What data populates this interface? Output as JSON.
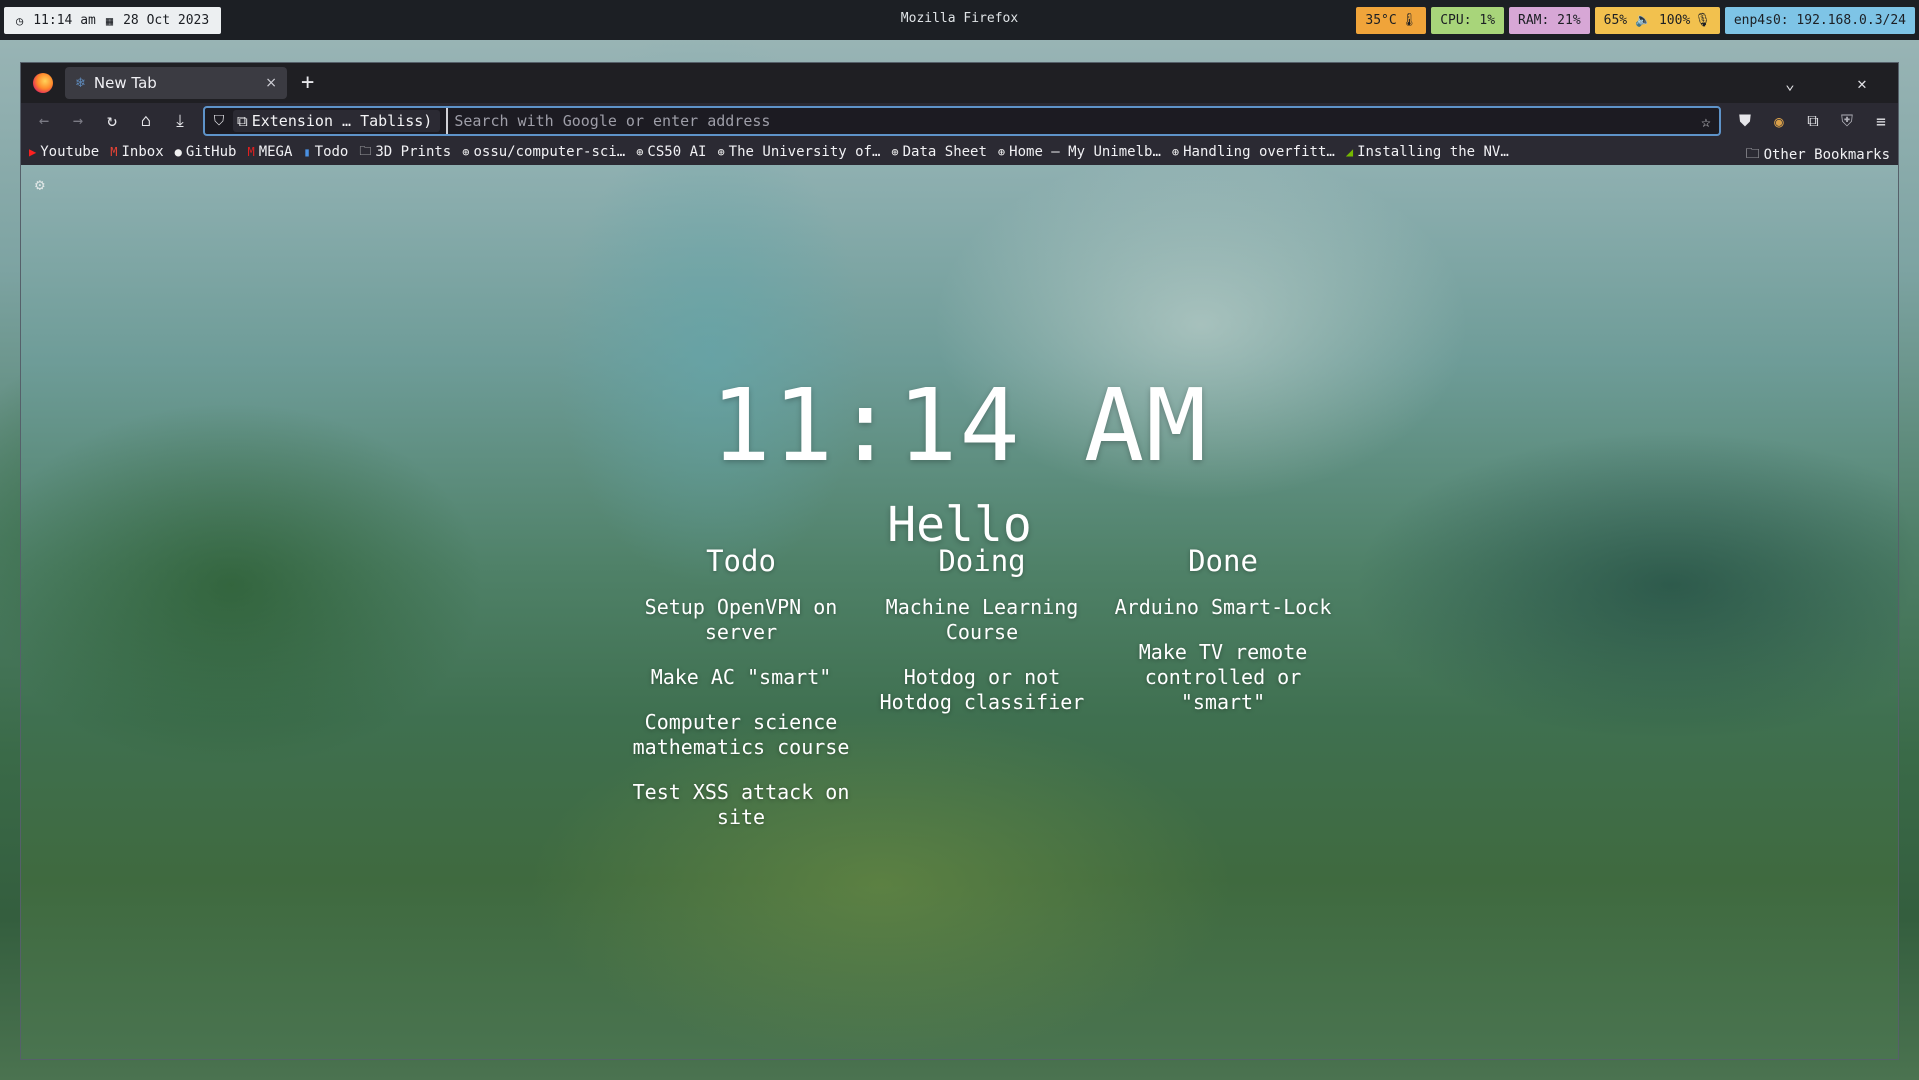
{
  "topbar": {
    "time": "11:14 am",
    "date": "28 Oct 2023",
    "window_title": "Mozilla Firefox",
    "temperature": "35°C",
    "cpu": "CPU: 1%",
    "ram": "RAM: 21%",
    "battery_volume": "65% 🔈 100%",
    "network": "enp4s0: 192.168.0.3/24",
    "colors": {
      "temperature": "#f0a43a",
      "cpu": "#a8d57a",
      "ram": "#d7a7d6",
      "battery_volume": "#f2c14e",
      "network": "#7ec4e6"
    }
  },
  "browser": {
    "tab": {
      "title": "New Tab",
      "close": "×"
    },
    "newtab": "+",
    "urlbar": {
      "extension_label": "Extension … Tabliss)",
      "placeholder": "Search with Google or enter address"
    },
    "bookmarks": [
      {
        "label": "Youtube",
        "icon": "youtube-icon",
        "glyph": "▶",
        "color": "#ff2020"
      },
      {
        "label": "Inbox",
        "icon": "gmail-icon",
        "glyph": "M",
        "color": "#ea4335"
      },
      {
        "label": "GitHub",
        "icon": "github-icon",
        "glyph": "●",
        "color": "#f0f0f0"
      },
      {
        "label": "MEGA",
        "icon": "mega-icon",
        "glyph": "M",
        "color": "#e02020"
      },
      {
        "label": "Todo",
        "icon": "trello-icon",
        "glyph": "▮",
        "color": "#4a90e2"
      },
      {
        "label": "3D Prints",
        "icon": "folder-icon",
        "glyph": "🗀",
        "color": "#f0f0f0"
      },
      {
        "label": "ossu/computer-sci…",
        "icon": "globe-icon",
        "glyph": "⊕",
        "color": "#f0f0f0"
      },
      {
        "label": "CS50 AI",
        "icon": "globe-icon",
        "glyph": "⊕",
        "color": "#f0f0f0"
      },
      {
        "label": "The University of…",
        "icon": "globe-icon",
        "glyph": "⊕",
        "color": "#f0f0f0"
      },
      {
        "label": "Data Sheet",
        "icon": "globe-icon",
        "glyph": "⊕",
        "color": "#f0f0f0"
      },
      {
        "label": "Home — My Unimelb…",
        "icon": "globe-icon",
        "glyph": "⊕",
        "color": "#f0f0f0"
      },
      {
        "label": "Handling overfitt…",
        "icon": "globe-icon",
        "glyph": "⊕",
        "color": "#f0f0f0"
      },
      {
        "label": "Installing the NV…",
        "icon": "nvidia-icon",
        "glyph": "◢",
        "color": "#76b900"
      }
    ],
    "other_bookmarks": "Other Bookmarks"
  },
  "page": {
    "time": "11:14 AM",
    "greeting": "Hello",
    "columns": [
      {
        "title": "Todo",
        "cards": [
          "Setup OpenVPN on server",
          "Make AC \"smart\"",
          "Computer science mathematics course",
          "Test XSS attack on site"
        ]
      },
      {
        "title": "Doing",
        "cards": [
          "Machine Learning Course",
          "Hotdog or not Hotdog classifier"
        ]
      },
      {
        "title": "Done",
        "cards": [
          "Arduino Smart-Lock",
          "Make TV remote controlled or \"smart\""
        ]
      }
    ]
  }
}
